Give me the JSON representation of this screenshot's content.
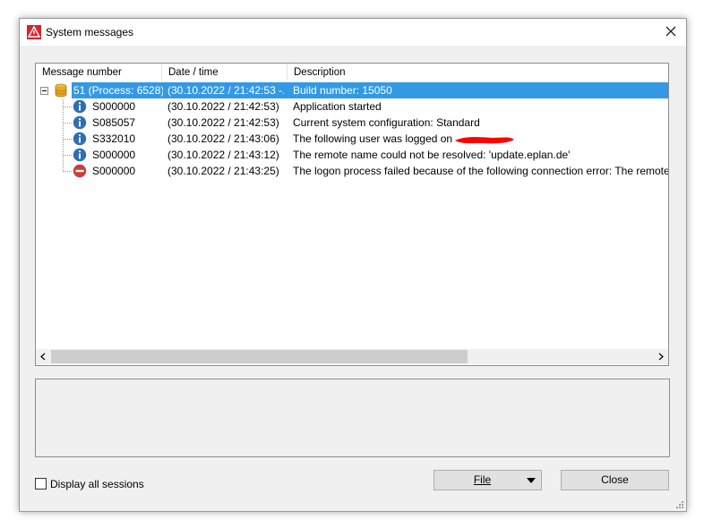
{
  "window": {
    "title": "System messages",
    "close_glyph": "✕"
  },
  "grid": {
    "columns": [
      "Message number",
      "Date / time",
      "Description"
    ],
    "rows": [
      {
        "number": "51 (Process: 6528)",
        "date": "(30.10.2022 / 21:42:53 -...",
        "desc": "Build number: 15050",
        "icon": "database-icon",
        "selected": true
      },
      {
        "number": "S000000",
        "date": "(30.10.2022 / 21:42:53)",
        "desc": "Application started",
        "icon": "info-icon"
      },
      {
        "number": "S085057",
        "date": "(30.10.2022 / 21:42:53)",
        "desc": "Current system configuration: Standard",
        "icon": "info-icon"
      },
      {
        "number": "S332010",
        "date": "(30.10.2022 / 21:43:06)",
        "desc": "The following user was logged on",
        "icon": "info-icon",
        "redacted": true
      },
      {
        "number": "S000000",
        "date": "(30.10.2022 / 21:43:12)",
        "desc": "The remote name could not be resolved: 'update.eplan.de'",
        "icon": "info-icon"
      },
      {
        "number": "S000000",
        "date": "(30.10.2022 / 21:43:25)",
        "desc": "The logon process failed because of the following connection error: The remote",
        "icon": "error-icon"
      }
    ]
  },
  "footer": {
    "display_all_sessions": "Display all sessions",
    "file_button": "File",
    "close_button": "Close"
  },
  "colors": {
    "selection": "#3399e5",
    "info": "#2f6db5",
    "error": "#d23b3b",
    "redaction": "#ff0000"
  }
}
